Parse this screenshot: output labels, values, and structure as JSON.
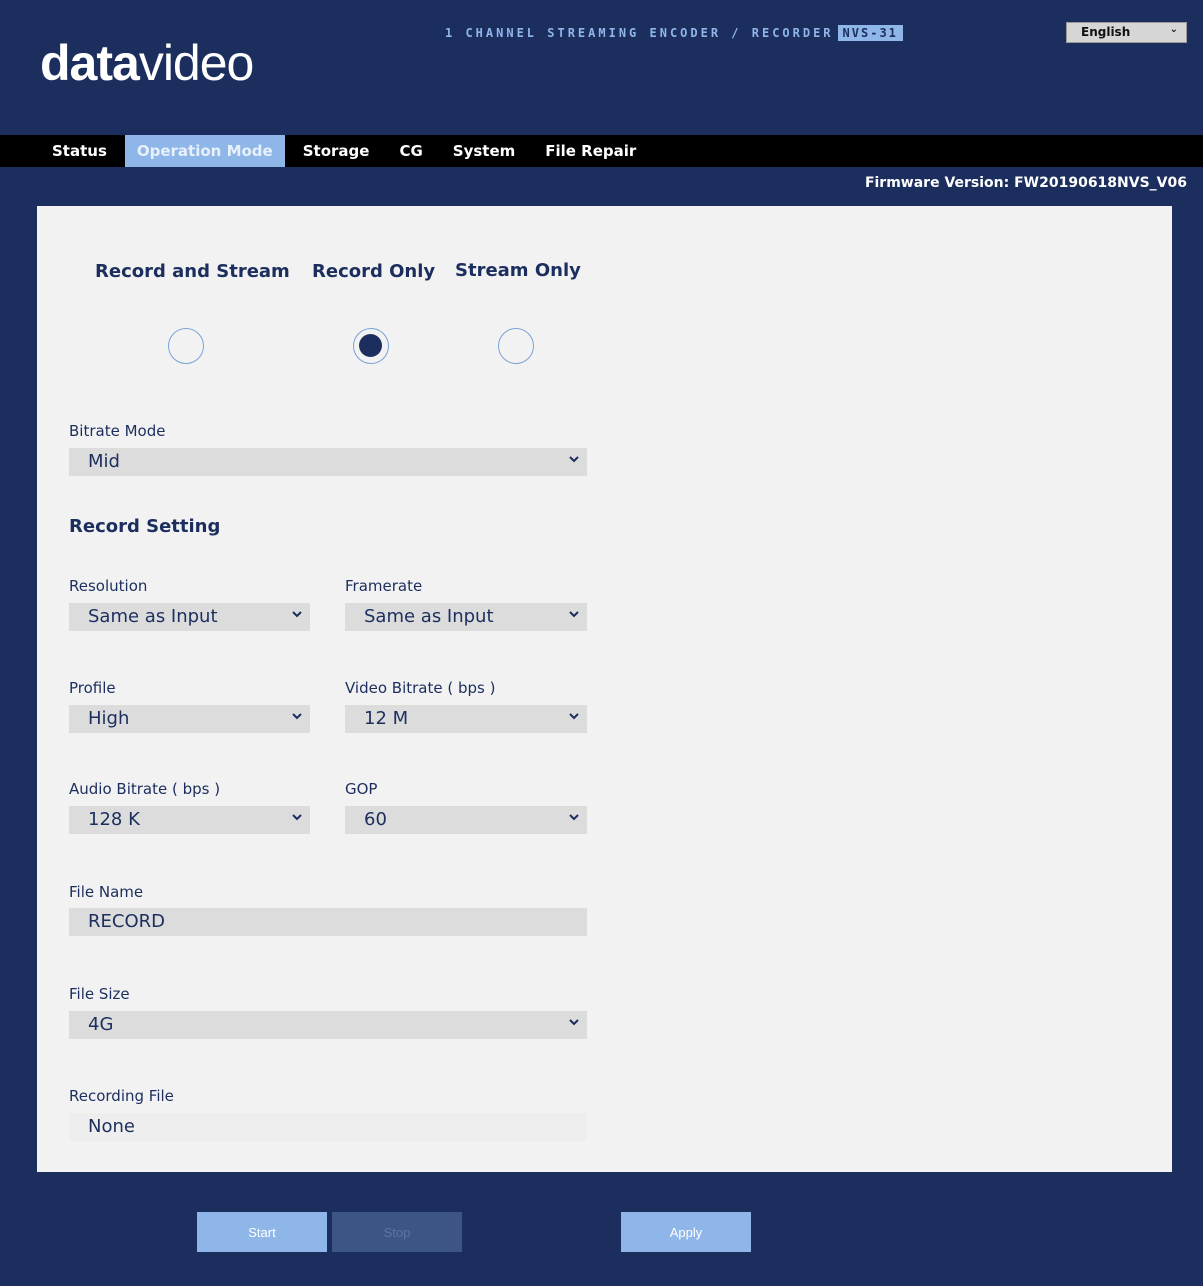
{
  "header": {
    "logo_bold": "data",
    "logo_light": "video",
    "product_title": "1 CHANNEL STREAMING ENCODER / RECORDER",
    "model": "NVS-31",
    "language": "English"
  },
  "nav": {
    "tabs": [
      "Status",
      "Operation Mode",
      "Storage",
      "CG",
      "System",
      "File Repair"
    ],
    "active": "Operation Mode"
  },
  "firmware": "Firmware Version: FW20190618NVS_V06",
  "modes": {
    "options": [
      "Record and Stream",
      "Record Only",
      "Stream Only"
    ],
    "selected": "Record Only"
  },
  "bitrate_mode": {
    "label": "Bitrate Mode",
    "value": "Mid"
  },
  "record_setting": {
    "title": "Record Setting",
    "resolution": {
      "label": "Resolution",
      "value": "Same as Input"
    },
    "framerate": {
      "label": "Framerate",
      "value": "Same as Input"
    },
    "profile": {
      "label": "Profile",
      "value": "High"
    },
    "video_bitrate": {
      "label": "Video Bitrate ( bps )",
      "value": "12 M"
    },
    "audio_bitrate": {
      "label": "Audio Bitrate ( bps )",
      "value": "128 K"
    },
    "gop": {
      "label": "GOP",
      "value": "60"
    },
    "file_name": {
      "label": "File Name",
      "value": "RECORD"
    },
    "file_size": {
      "label": "File Size",
      "value": "4G"
    },
    "recording_file": {
      "label": "Recording File",
      "value": "None"
    }
  },
  "buttons": {
    "start": "Start",
    "stop": "Stop",
    "apply": "Apply"
  },
  "colors": {
    "background": "#1b2e5e",
    "accent": "#8fb6e8",
    "panel": "#f2f2f2"
  }
}
